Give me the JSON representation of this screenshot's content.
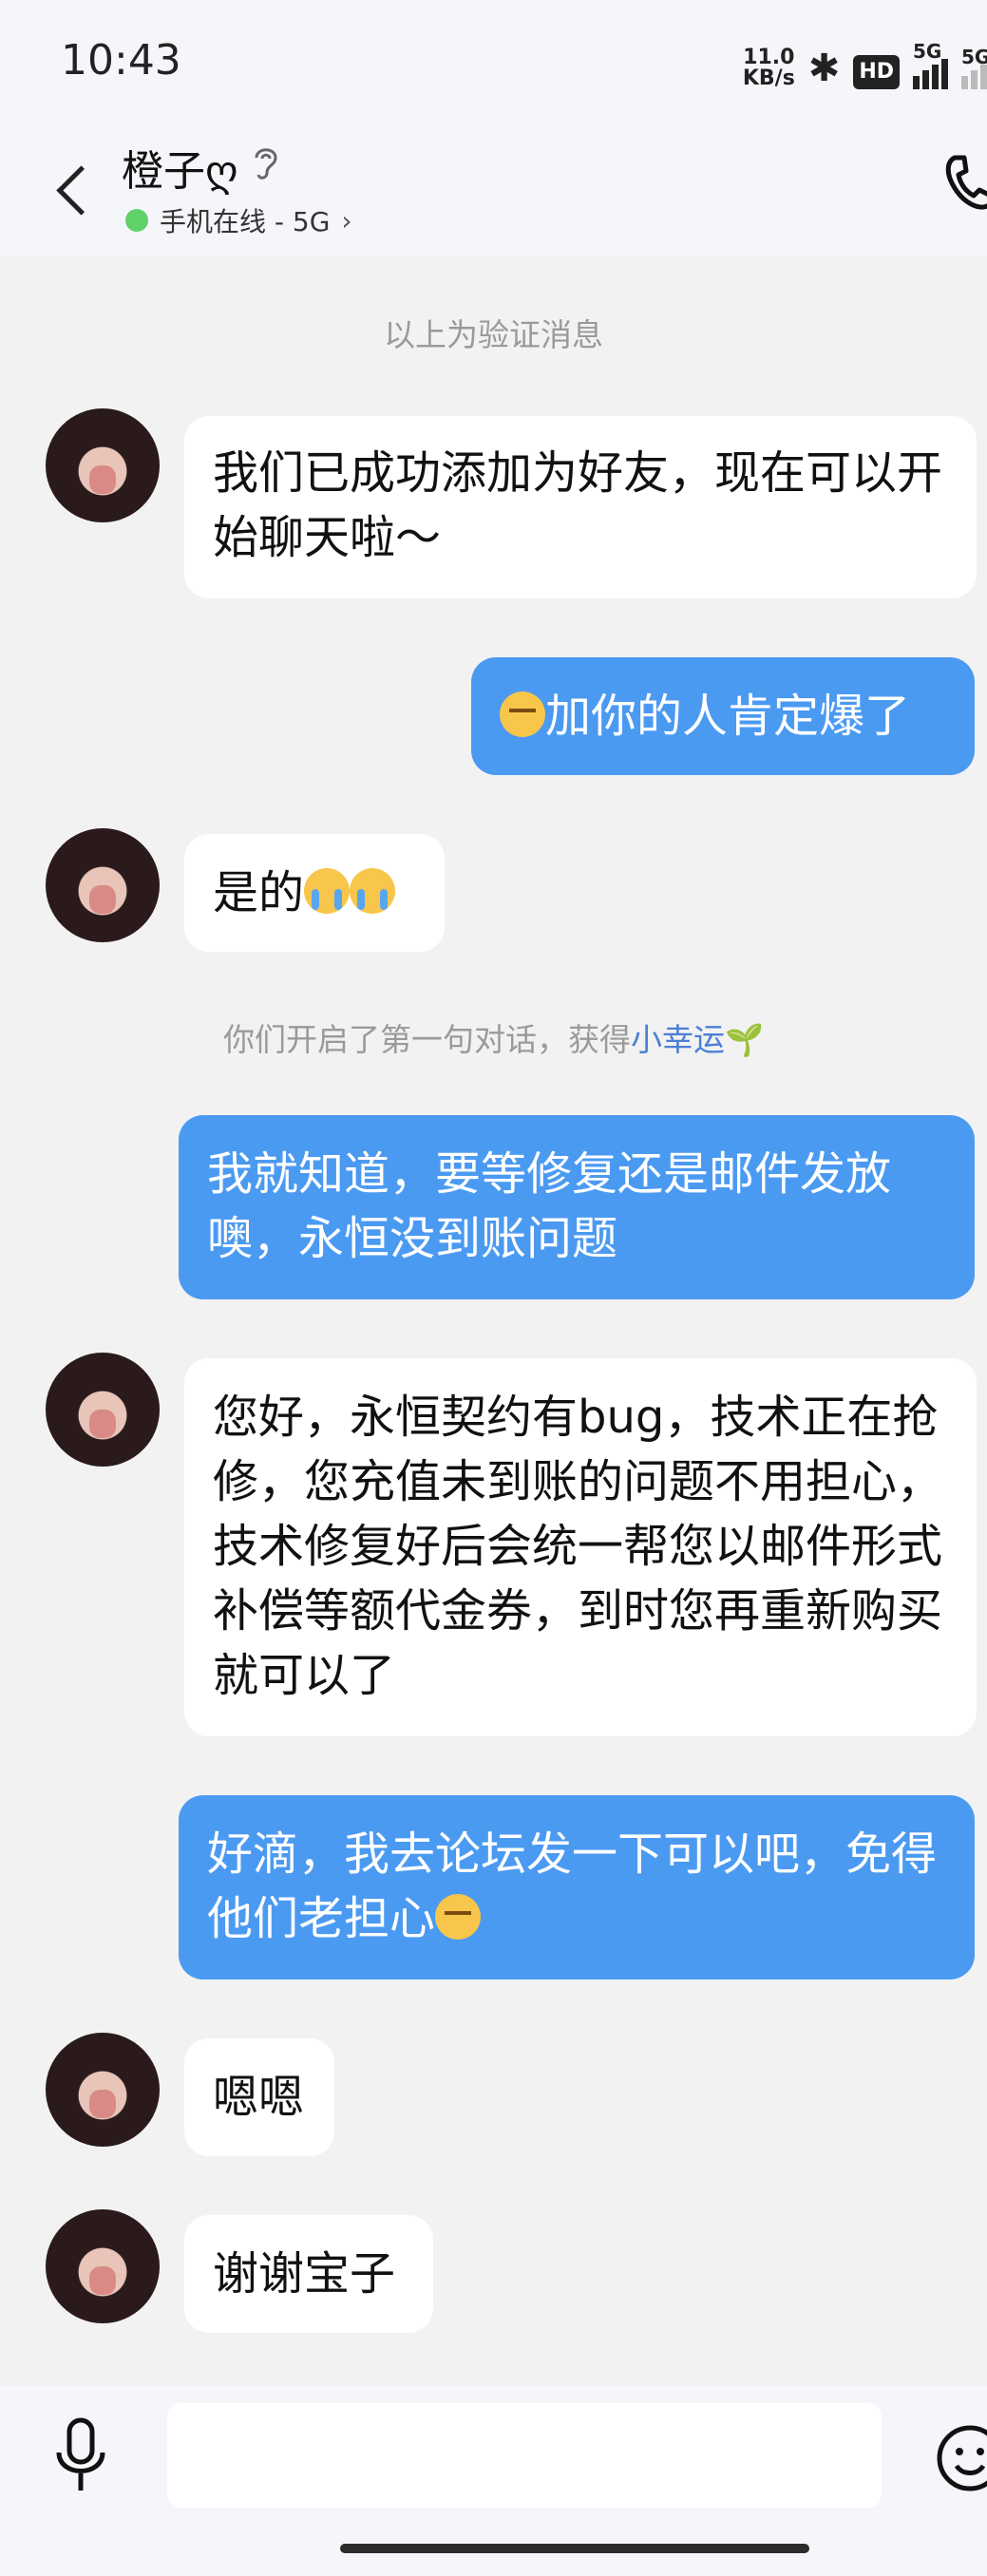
{
  "status_bar": {
    "time": "10:43",
    "net_speed_value": "11.0",
    "net_speed_unit": "KB/s",
    "hd_badge": "HD",
    "signal_1": "5G",
    "signal_2": "5G"
  },
  "header": {
    "contact_name": "橙子ღ",
    "status": "手机在线 - 5G",
    "status_color": "#5fd36a"
  },
  "messages": [
    {
      "type": "system",
      "text": "以上为验证消息"
    },
    {
      "type": "in",
      "text": "我们已成功添加为好友，现在可以开始聊天啦～"
    },
    {
      "type": "out",
      "emoji": "smirk",
      "text": "加你的人肯定爆了"
    },
    {
      "type": "in",
      "text": "是的",
      "emoji": "cry"
    },
    {
      "type": "system",
      "text": "你们开启了第一句对话，获得",
      "link": "小幸运"
    },
    {
      "type": "out",
      "text": "我就知道，要等修复还是邮件发放噢，永恒没到账问题"
    },
    {
      "type": "in",
      "text": "您好，永恒契约有bug，技术正在抢修，您充值未到账的问题不用担心，技术修复好后会统一帮您以邮件形式补偿等额代金券，到时您再重新购买就可以了"
    },
    {
      "type": "out",
      "text": "好滴，我去论坛发一下可以吧，免得他们老担心",
      "emoji": "smirk"
    },
    {
      "type": "in",
      "text": "嗯嗯"
    },
    {
      "type": "in",
      "text": "谢谢宝子"
    }
  ],
  "colors": {
    "out_bubble": "#4b9af2",
    "in_bubble": "#ffffff",
    "link": "#4a7fd6"
  }
}
